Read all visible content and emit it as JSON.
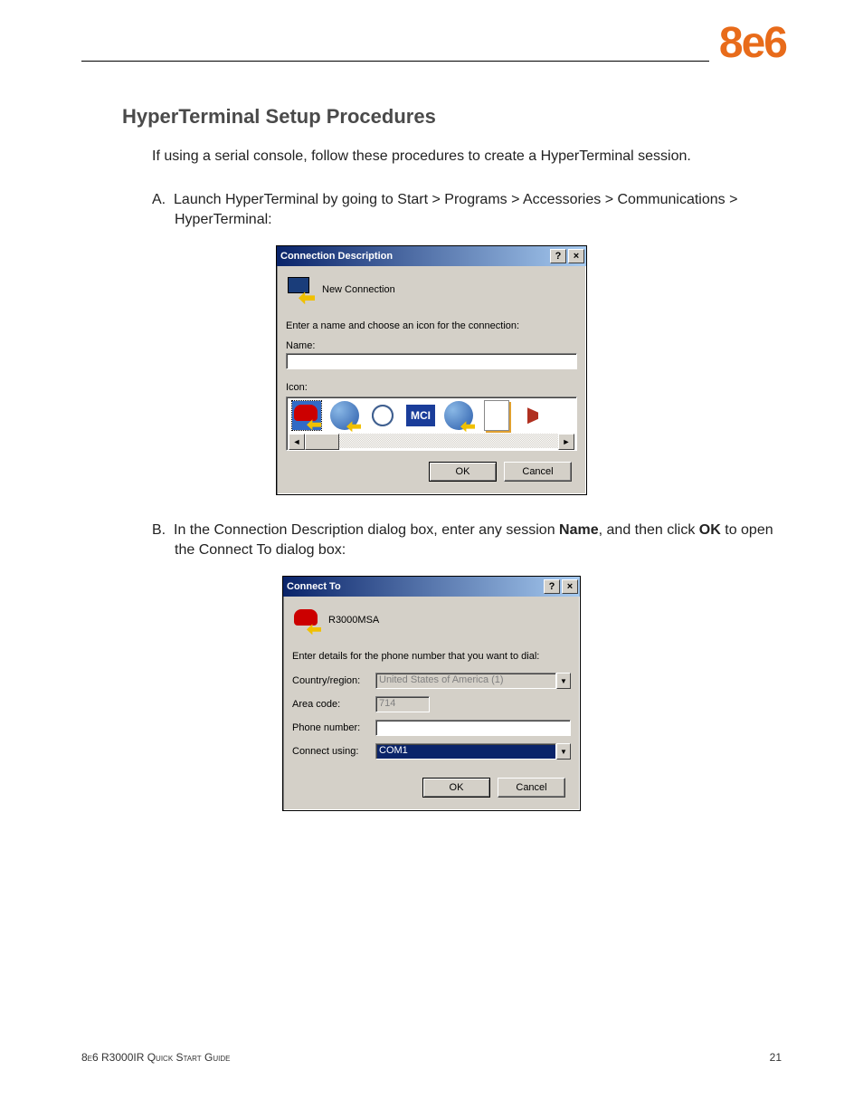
{
  "brand": "8e6",
  "sectionTitle": "HyperTerminal Setup Procedures",
  "intro": "If using a serial console, follow these procedures to create a HyperTerminal session.",
  "stepA": {
    "marker": "A.",
    "text": "Launch HyperTerminal by going to Start > Programs > Accessories > Communications > HyperTerminal:"
  },
  "dialog1": {
    "title": "Connection Description",
    "help": "?",
    "close": "×",
    "connName": "New Connection",
    "instruction": "Enter a name and choose an icon for the connection:",
    "nameLabel": "Name:",
    "nameValue": "",
    "iconLabel": "Icon:",
    "mci": "MCI",
    "scrollLeft": "◄",
    "scrollRight": "►",
    "ok": "OK",
    "cancel": "Cancel"
  },
  "stepB": {
    "marker": "B.",
    "prefix": "In the Connection Description dialog box, enter any session ",
    "bold1": "Name",
    "mid": ", and then click ",
    "bold2": "OK",
    "suffix": " to open the Connect To dialog box:"
  },
  "dialog2": {
    "title": "Connect To",
    "help": "?",
    "close": "×",
    "connName": "R3000MSA",
    "instruction": "Enter details for the phone number that you want to dial:",
    "countryLabel": "Country/region:",
    "countryValue": "United States of America (1)",
    "areaLabel": "Area code:",
    "areaValue": "714",
    "phoneLabel": "Phone number:",
    "phoneValue": "",
    "connectLabel": "Connect using:",
    "connectValue": "COM1",
    "drop": "▼",
    "ok": "OK",
    "cancel": "Cancel"
  },
  "footer": {
    "left": "8e6 R3000IR Quick Start Guide",
    "right": "21"
  }
}
